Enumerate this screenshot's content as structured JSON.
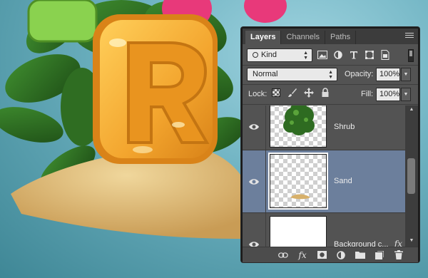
{
  "panel": {
    "tabs": [
      {
        "label": "Layers"
      },
      {
        "label": "Channels"
      },
      {
        "label": "Paths"
      }
    ],
    "filter": {
      "kind_value": "Kind",
      "icons": [
        "image-filter-icon",
        "adjustment-filter-icon",
        "type-filter-icon",
        "shape-filter-icon",
        "smart-object-filter-icon"
      ]
    },
    "blend_mode": "Normal",
    "opacity_label": "Opacity:",
    "opacity_value": "100%",
    "lock_label": "Lock:",
    "fill_label": "Fill:",
    "fill_value": "100%",
    "layers": [
      {
        "name": "Shrub",
        "visible": true,
        "selected": false
      },
      {
        "name": "Sand",
        "visible": true,
        "selected": true
      },
      {
        "name": "Background c...",
        "visible": true,
        "selected": false,
        "fx": "fx"
      }
    ],
    "bottom_icons": [
      "link-layers-icon",
      "fx-icon",
      "mask-icon",
      "adjustment-layer-icon",
      "group-folder-icon",
      "new-layer-icon",
      "trash-icon"
    ],
    "fx_symbol": "fx"
  },
  "colors": {
    "panel_bg": "#535353",
    "selected_row": "#6c7f9c",
    "background": "#6fb3c2",
    "letter": "#f3a52e",
    "sand": "#e2c081"
  }
}
